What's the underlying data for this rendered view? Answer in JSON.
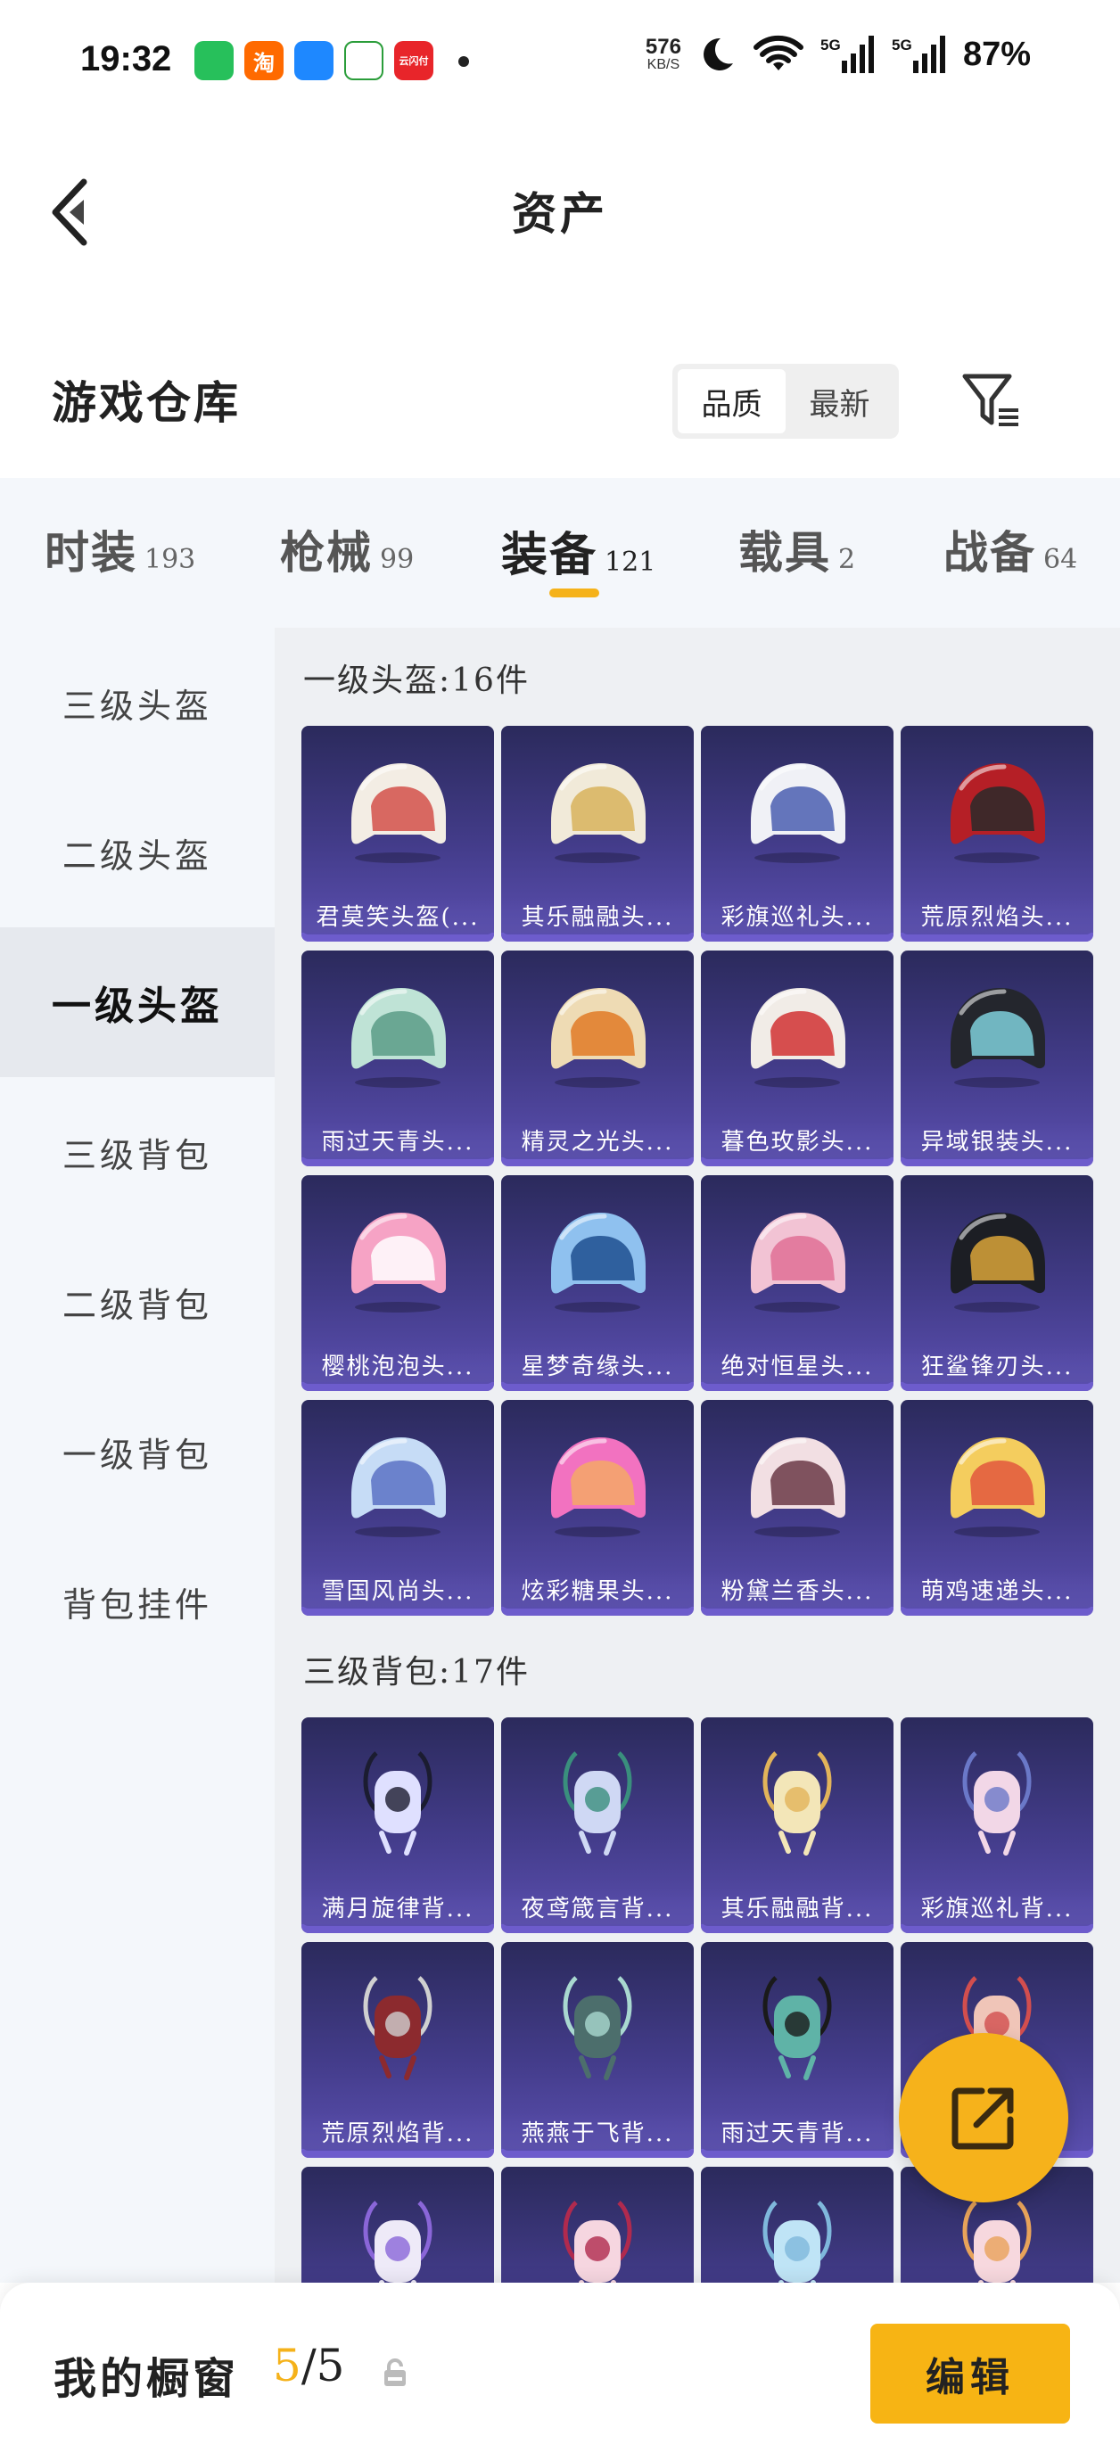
{
  "status_bar": {
    "time": "19:32",
    "net_speed_value": "576",
    "net_speed_unit": "KB/S",
    "battery": "87%",
    "apps": [
      {
        "icon": "wechat-icon",
        "color": "#27c05b"
      },
      {
        "icon": "taobao-icon",
        "color": "#ff6a00",
        "glyph": "淘"
      },
      {
        "icon": "send-icon",
        "color": "#1e88ff"
      },
      {
        "icon": "bank-icon",
        "color": "#ffffff"
      },
      {
        "icon": "cloud-pay-icon",
        "color": "#e8252a",
        "glyph": "云闪付"
      }
    ]
  },
  "header": {
    "title": "资产"
  },
  "warehouse": {
    "title": "游戏仓库",
    "sort_options": [
      "品质",
      "最新"
    ],
    "active_sort": "品质"
  },
  "tabs": [
    {
      "name": "时装",
      "count": "193"
    },
    {
      "name": "枪械",
      "count": "99"
    },
    {
      "name": "装备",
      "count": "121",
      "active": true
    },
    {
      "name": "载具",
      "count": "2"
    },
    {
      "name": "战备",
      "count": "64"
    }
  ],
  "sidebar": [
    {
      "label": "三级头盔"
    },
    {
      "label": "二级头盔"
    },
    {
      "label": "一级头盔",
      "active": true
    },
    {
      "label": "三级背包"
    },
    {
      "label": "二级背包"
    },
    {
      "label": "一级背包"
    },
    {
      "label": "背包挂件"
    }
  ],
  "sections": [
    {
      "heading": "一级头盔:16件",
      "items": [
        {
          "label": "君莫笑头盔(...",
          "color": "#f3ede4",
          "accent": "#d2504a"
        },
        {
          "label": "其乐融融头...",
          "color": "#f1ead9",
          "accent": "#d8b35c"
        },
        {
          "label": "彩旗巡礼头...",
          "color": "#f0f1f6",
          "accent": "#4b5fb0"
        },
        {
          "label": "荒原烈焰头...",
          "color": "#b51f26",
          "accent": "#2a2a2a"
        },
        {
          "label": "雨过天青头...",
          "color": "#bfe3d6",
          "accent": "#5a9c87"
        },
        {
          "label": "精灵之光头...",
          "color": "#eedbb4",
          "accent": "#e07a26"
        },
        {
          "label": "暮色玫影头...",
          "color": "#f1ece7",
          "accent": "#d13333"
        },
        {
          "label": "异域银装头...",
          "color": "#24262d",
          "accent": "#7fd0dc"
        },
        {
          "label": "樱桃泡泡头...",
          "color": "#f6a3c5",
          "accent": "#ffffff"
        },
        {
          "label": "星梦奇缘头...",
          "color": "#8fc1ef",
          "accent": "#1f4f8f"
        },
        {
          "label": "绝对恒星头...",
          "color": "#f2c3d4",
          "accent": "#e07095"
        },
        {
          "label": "狂鲨锋刃头...",
          "color": "#1c1e24",
          "accent": "#d9a53a"
        },
        {
          "label": "雪国风尚头...",
          "color": "#c6dcf6",
          "accent": "#5a72c4"
        },
        {
          "label": "炫彩糖果头...",
          "color": "#f272c0",
          "accent": "#f4a866"
        },
        {
          "label": "粉黛兰香头...",
          "color": "#f2dfe3",
          "accent": "#6b3a46"
        },
        {
          "label": "萌鸡速递头...",
          "color": "#f4cd5e",
          "accent": "#e2573d"
        }
      ]
    },
    {
      "heading": "三级背包:17件",
      "items": [
        {
          "label": "满月旋律背...",
          "color": "#dfe0ff",
          "accent": "#1b1c30"
        },
        {
          "label": "夜鸢箴言背...",
          "color": "#cfd8f4",
          "accent": "#3a8f7d"
        },
        {
          "label": "其乐融融背...",
          "color": "#f3e6b8",
          "accent": "#e2b45a"
        },
        {
          "label": "彩旗巡礼背...",
          "color": "#f2d7e7",
          "accent": "#6a78c8"
        },
        {
          "label": "荒原烈焰背...",
          "color": "#8c2a2e",
          "accent": "#d0d0d0"
        },
        {
          "label": "燕燕于飞背...",
          "color": "#4c6e6c",
          "accent": "#a9d8d0"
        },
        {
          "label": "雨过天青背...",
          "color": "#5fb3a7",
          "accent": "#1a1a1a"
        },
        {
          "label": "",
          "color": "#f0c5b8",
          "accent": "#d24e4e"
        },
        {
          "label": "",
          "color": "#eeeaf8",
          "accent": "#8a66d8"
        },
        {
          "label": "",
          "color": "#f6d6e0",
          "accent": "#b02a4e"
        },
        {
          "label": "",
          "color": "#bfe4f6",
          "accent": "#7fb8dc"
        },
        {
          "label": "",
          "color": "#f7d8de",
          "accent": "#e8a35a"
        }
      ]
    }
  ],
  "showcase": {
    "title": "我的橱窗",
    "current": "5",
    "total": "/5",
    "edit_label": "编辑"
  },
  "colors": {
    "accent": "#f5b21a",
    "card_top": "#2b2a5c",
    "card_bottom": "#5b4fb0",
    "panel_bg": "#eef0f3"
  }
}
